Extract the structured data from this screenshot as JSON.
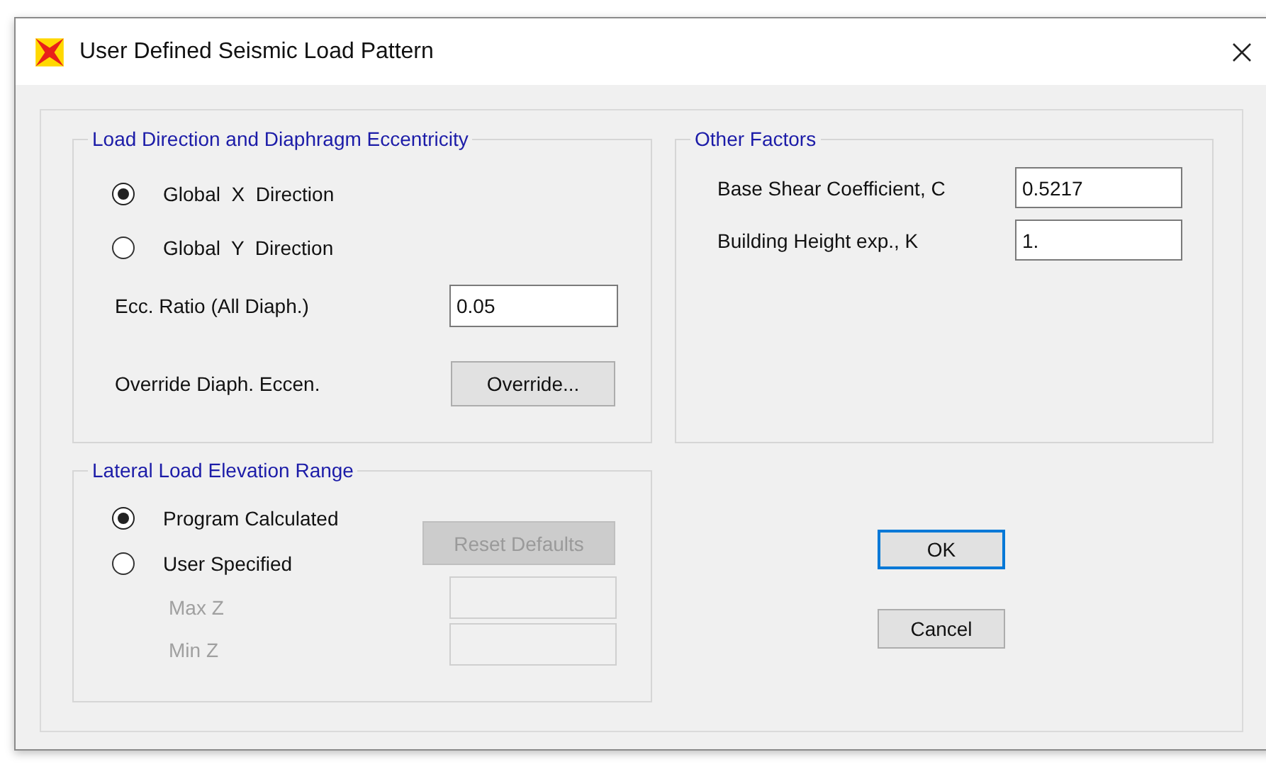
{
  "window": {
    "title": "User Defined Seismic Load Pattern"
  },
  "load_direction": {
    "title": "Load Direction and Diaphragm Eccentricity",
    "options": [
      {
        "label": "Global  X  Direction",
        "selected": true
      },
      {
        "label": "Global  Y  Direction",
        "selected": false
      }
    ],
    "ecc_ratio": {
      "label": "Ecc. Ratio (All Diaph.)",
      "value": "0.05"
    },
    "override": {
      "label": "Override Diaph. Eccen.",
      "button": "Override..."
    }
  },
  "other_factors": {
    "title": "Other Factors",
    "fields": [
      {
        "label": "Base Shear Coefficient, C",
        "value": "0.5217"
      },
      {
        "label": "Building Height exp., K",
        "value": "1."
      }
    ]
  },
  "elevation_range": {
    "title": "Lateral Load Elevation Range",
    "options": [
      {
        "label": "Program Calculated",
        "selected": true
      },
      {
        "label": "User Specified",
        "selected": false
      }
    ],
    "reset_button": {
      "label": "Reset Defaults",
      "disabled": true
    },
    "fields": [
      {
        "label": "Max Z",
        "disabled": true
      },
      {
        "label": "Min Z",
        "disabled": true
      }
    ]
  },
  "buttons": [
    {
      "label": "OK",
      "default": true
    },
    {
      "label": "Cancel",
      "default": false
    }
  ]
}
